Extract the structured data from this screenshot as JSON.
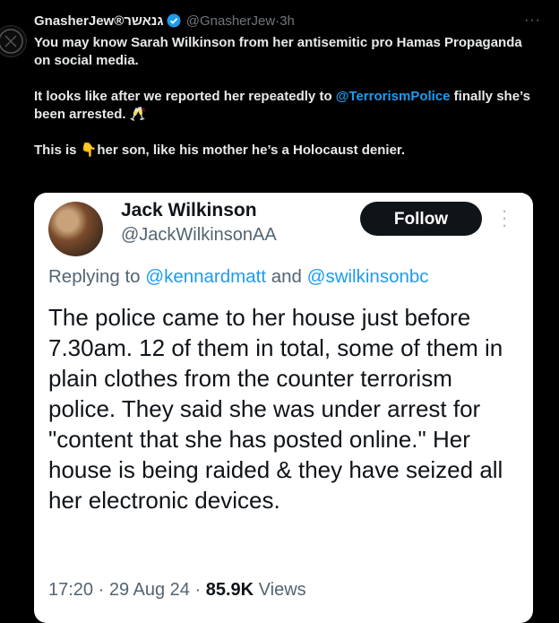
{
  "tweet": {
    "display_name": "GnasherJew®גנאשר",
    "handle": "@GnasherJew",
    "separator": "·",
    "time": "3h",
    "more": "···",
    "line1": "You may know Sarah Wilkinson from her antisemitic pro Hamas Propaganda on social media.",
    "line2_pre": "It looks like after we reported her repeatedly to ",
    "line2_mention": "@TerrorismPolice",
    "line2_post": " finally she’s been arrested. ",
    "line2_emoji": "🥂",
    "line3_pre": "This is ",
    "line3_emoji": "👇",
    "line3_post": "her son, like his mother he’s a Holocaust denier."
  },
  "embedded": {
    "name": "Jack Wilkinson",
    "handle": "@JackWilkinsonAA",
    "follow_label": "Follow",
    "replying_prefix": "Replying to ",
    "reply_mention1": "@kennardmatt",
    "reply_and": " and ",
    "reply_mention2": "@swilkinsonbc",
    "body": "The police came to her house just before 7.30am. 12 of them in total, some of them in plain clothes from the counter terrorism police. They said she was under arrest for \"content that she has posted online.\" Her house is being raided & they have seized all her electronic devices.",
    "time": "17:20",
    "sep1": " · ",
    "date": "29 Aug 24",
    "sep2": " · ",
    "views_count": "85.9K",
    "views_label": " Views"
  },
  "colors": {
    "accent": "#1d9bf0",
    "background": "#000000",
    "card": "#ffffff"
  }
}
